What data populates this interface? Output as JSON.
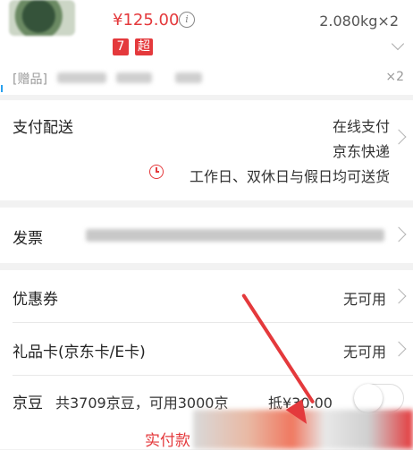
{
  "product": {
    "price": "¥125.00",
    "info_icon": "i",
    "weight_qty": "2.080kg×2",
    "tag_seven": "7",
    "tag_super": "超",
    "gift_label": "[赠品]",
    "gift_qty": "×2"
  },
  "payment_delivery": {
    "label": "支付配送",
    "pay_method": "在线支付",
    "carrier": "京东快递",
    "delivery_time": "工作日、双休日与假日均可送货"
  },
  "invoice": {
    "label": "发票"
  },
  "coupon": {
    "label": "优惠券",
    "value": "无可用"
  },
  "giftcard": {
    "label": "礼品卡(京东卡/E卡)",
    "value": "无可用"
  },
  "jingdou": {
    "label": "京豆",
    "text": "共3709京豆，可用3000京",
    "deduct": "抵¥30.00",
    "enabled": false
  },
  "footer": {
    "pay_label": "实付款"
  },
  "colors": {
    "accent": "#e4393c",
    "annotation_arrow": "#e4393c"
  },
  "icons": [
    "info-icon",
    "chevron-down-icon",
    "chevron-right-icon",
    "clock-icon",
    "annotation-arrow"
  ]
}
